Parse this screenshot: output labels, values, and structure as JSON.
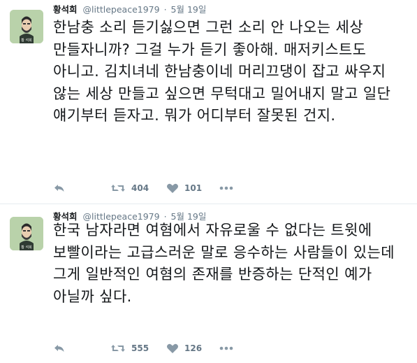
{
  "tweets": [
    {
      "author_name": "황석희",
      "handle": "@littlepeace1979",
      "separator": "·",
      "date": "5월 19일",
      "avatar_caption": "황 석희",
      "text": "한남충 소리 듣기싫으면 그런 소리 안 나오는 세상 만들자니까? 그걸 누가 듣기 좋아해. 매저키스트도 아니고. 김치녀네 한남충이네 머리끄댕이 잡고 싸우지 않는 세상 만들고 싶으면 무턱대고 밀어내지 말고 일단 얘기부터 듣자고. 뭐가 어디부터 잘못된 건지.",
      "retweets": "404",
      "likes": "101"
    },
    {
      "author_name": "황석희",
      "handle": "@littlepeace1979",
      "separator": "·",
      "date": "5월 19일",
      "avatar_caption": "황 석희",
      "text": "한국 남자라면 여혐에서 자유로울 수 없다는 트윗에 보빨이라는 고급스러운 말로 응수하는 사람들이 있는데 그게 일반적인 여혐의 존재를 반증하는 단적인 예가 아닐까 싶다.",
      "retweets": "555",
      "likes": "126"
    }
  ],
  "colors": {
    "text": "#14171a",
    "secondary": "#657786",
    "icon": "#8899a6",
    "avatar_bg": "#b9d2aa",
    "divider": "#e6ecf0"
  },
  "icons": [
    "reply-icon",
    "retweet-icon",
    "heart-icon",
    "more-icon"
  ]
}
